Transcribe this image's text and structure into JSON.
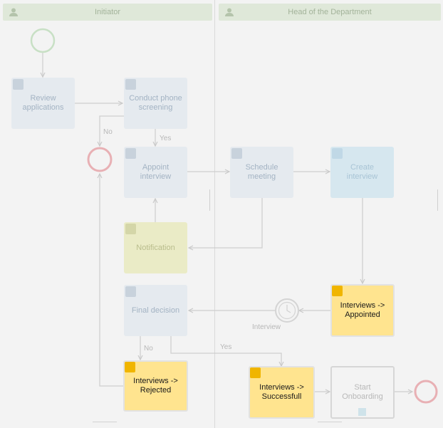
{
  "lanes": [
    {
      "title": "Initiator"
    },
    {
      "title": "Head of the Department"
    }
  ],
  "tasks": {
    "review": "Review applications",
    "phone": "Conduct phone screening",
    "appoint": "Appoint interview",
    "schedule": "Schedule meeting",
    "create": "Create interview",
    "notification": "Notification",
    "final": "Final decision",
    "appointed": "Interviews -> Appointed",
    "rejected": "Interviews -> Rejected",
    "successful": "Interviews -> Successfull",
    "onboarding": "Start Onboarding"
  },
  "edges": {
    "no_top": "No",
    "yes_top": "Yes",
    "no_bottom": "No",
    "yes_bottom": "Yes",
    "timer": "Interview"
  },
  "colors": {
    "start_event": "#c8e0c5",
    "end_event": "#e8b0b4",
    "yellow_task": "#ffe48f",
    "yellow_icon": "#f0b500"
  },
  "icons": {
    "lane": "user-icon",
    "task": "user-icon",
    "create": "plus-icon",
    "notification": "message-icon",
    "status": "swap-icon",
    "timer": "clock-icon"
  }
}
